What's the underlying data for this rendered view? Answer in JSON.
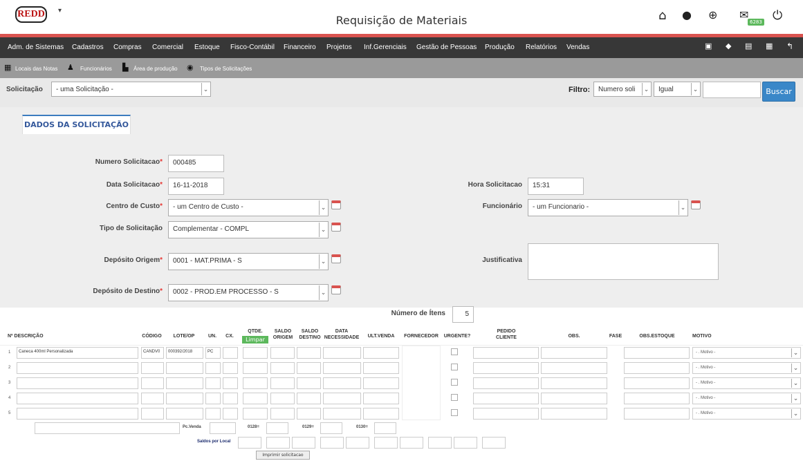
{
  "header": {
    "logo_text": "REDD",
    "title": "Requisição de Materiais",
    "mail_count": "6283"
  },
  "menu": [
    "Adm. de Sistemas",
    "Cadastros",
    "Compras",
    "Comercial",
    "Estoque",
    "Fisco-Contábil",
    "Financeiro",
    "Projetos",
    "Inf.Gerenciais",
    "Gestão de Pessoas",
    "Produção",
    "Relatórios",
    "Vendas"
  ],
  "subtoolbar": [
    "Locais das Notas",
    "Funcionários",
    "Área de produção",
    "Tipos de Solicitações"
  ],
  "solicitacao": {
    "label": "Solicitação",
    "value": "- uma Solicitação -"
  },
  "filtro": {
    "label": "Filtro:",
    "field": "Numero soli",
    "operator": "Igual",
    "value": "",
    "button": "Buscar"
  },
  "tab": "DADOS DA SOLICITAÇÃO",
  "form": {
    "numero_label": "Numero Solicitacao",
    "numero": "000485",
    "data_label": "Data Solicitacao",
    "data": "16-11-2018",
    "hora_label": "Hora Solicitacao",
    "hora": "15:31",
    "centro_label": "Centro de Custo",
    "centro": "- um Centro de Custo -",
    "funcionario_label": "Funcionário",
    "funcionario": "- um Funcionario -",
    "tipo_label": "Tipo de Solicitação",
    "tipo": "Complementar - COMPL",
    "origem_label": "Depósito Origem",
    "origem": "0001 - MAT.PRIMA - S",
    "justificativa_label": "Justificativa",
    "destino_label": "Depósito de Destino",
    "destino": "0002 - PROD.EM PROCESSO - S",
    "itens_label": "Número de Ítens",
    "itens": "5",
    "required_mark": "*"
  },
  "table": {
    "headers": {
      "num_desc": "Nº DESCRIÇÃO",
      "codigo": "CÓDIGO",
      "lote": "LOTE/OP",
      "un": "UN.",
      "cx": "CX.",
      "qtde": "QTDE.",
      "saldo_origem_1": "SALDO",
      "saldo_origem_2": "ORIGEM",
      "saldo_destino_1": "SALDO",
      "saldo_destino_2": "DESTINO",
      "data_nec_1": "DATA",
      "data_nec_2": "NECESSIDADE",
      "ult_venda": "ULT.VENDA",
      "fornecedor": "FORNECEDOR",
      "urgente": "URGENTE?",
      "pedido_1": "PEDIDO",
      "pedido_2": "CLIENTE",
      "obs": "OBS.",
      "fase": "FASE",
      "obs_estoque": "OBS.ESTOQUE",
      "motivo": "MOTIVO"
    },
    "limpar": "Limpar",
    "motivo_placeholder": "- . Motivo -",
    "rows": [
      {
        "n": "1",
        "descricao": "Caneca 400ml Personalizada",
        "codigo": "CANDV0",
        "lote": "000392/2018",
        "un": "PC"
      },
      {
        "n": "2",
        "descricao": "",
        "codigo": "",
        "lote": "",
        "un": ""
      },
      {
        "n": "3",
        "descricao": "",
        "codigo": "",
        "lote": "",
        "un": ""
      },
      {
        "n": "4",
        "descricao": "",
        "codigo": "",
        "lote": "",
        "un": ""
      },
      {
        "n": "5",
        "descricao": "",
        "codigo": "",
        "lote": "",
        "un": ""
      }
    ]
  },
  "footer": {
    "pc_venda": "Pc.Venda",
    "l0128": "0128=",
    "l0129": "0129=",
    "l0130": "0130=",
    "saldos": "Saldos por Local",
    "imprimir": "Imprimir solicitacao"
  }
}
